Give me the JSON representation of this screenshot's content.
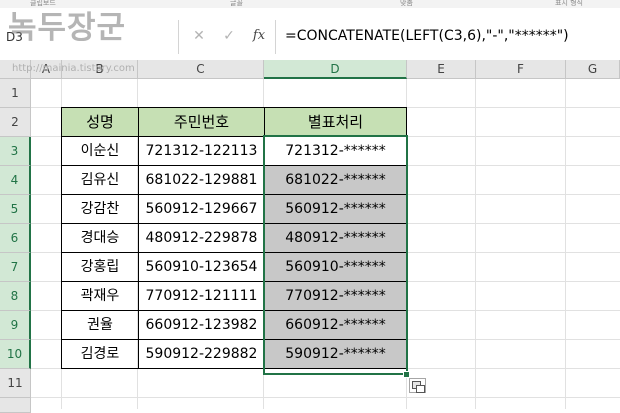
{
  "window": {
    "ribbon_fragments": [
      "클립보드",
      "글꼴",
      "맞춤",
      "표시 형식"
    ]
  },
  "formula_bar": {
    "name_box": "D3",
    "cancel_icon": "✕",
    "enter_icon": "✓",
    "fx_label": "fx",
    "formula": "=CONCATENATE(LEFT(C3,6),\"-\",\"******\")"
  },
  "watermark": {
    "title": "녹두장군",
    "url": "http://mainia.tistory.com"
  },
  "columns": [
    "A",
    "B",
    "C",
    "D",
    "E",
    "F",
    "G"
  ],
  "selected_column": "D",
  "rows": [
    "1",
    "2",
    "3",
    "4",
    "5",
    "6",
    "7",
    "8",
    "9",
    "10",
    "11"
  ],
  "table": {
    "headers": [
      "성명",
      "주민번호",
      "별표처리"
    ],
    "records": [
      {
        "name": "이순신",
        "id": "721312-122113",
        "masked": "721312-******"
      },
      {
        "name": "김유신",
        "id": "681022-129881",
        "masked": "681022-******"
      },
      {
        "name": "강감찬",
        "id": "560912-129667",
        "masked": "560912-******"
      },
      {
        "name": "경대승",
        "id": "480912-229878",
        "masked": "480912-******"
      },
      {
        "name": "강홍립",
        "id": "560910-123654",
        "masked": "560910-******"
      },
      {
        "name": "곽재우",
        "id": "770912-121111",
        "masked": "770912-******"
      },
      {
        "name": "권율",
        "id": "660912-123982",
        "masked": "660912-******"
      },
      {
        "name": "김경로",
        "id": "590912-229882",
        "masked": "590912-******"
      }
    ]
  },
  "colors": {
    "header_fill": "#c6e0b4",
    "selection_fill": "#c8c8c8",
    "selection_border": "#217346"
  },
  "icons": {
    "paste_options": "paste-options-icon",
    "fill_handle": "fill-handle"
  }
}
